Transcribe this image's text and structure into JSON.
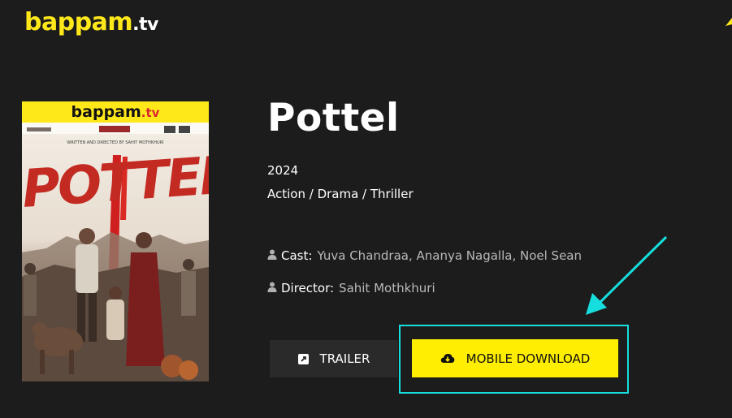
{
  "header": {
    "logo_main": "bappam",
    "logo_tld": ".tv"
  },
  "poster": {
    "logo_main": "bappam",
    "logo_tld": ".tv",
    "credits": "WRITTEN AND DIRECTED BY SAHIT MOTHKHURI",
    "title_art": "POTTEL"
  },
  "movie": {
    "title": "Pottel",
    "year": "2024",
    "genres": "Action / Drama / Thriller",
    "cast_label": "Cast:",
    "cast_value": "Yuva Chandraa, Ananya Nagalla, Noel Sean",
    "director_label": "Director:",
    "director_value": "Sahit Mothkhuri"
  },
  "actions": {
    "trailer_label": "TRAILER",
    "download_label": "MOBILE DOWNLOAD"
  },
  "colors": {
    "brand_yellow": "#ffe81a",
    "button_yellow": "#ffee00",
    "highlight_cyan": "#17dede",
    "background": "#1c1c1c"
  }
}
